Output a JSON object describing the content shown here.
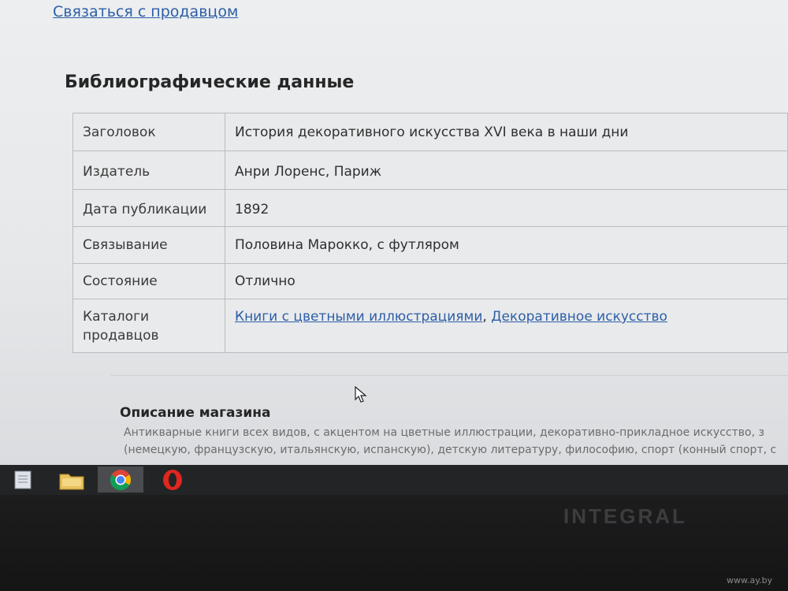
{
  "page": {
    "contact_link": "Связаться с продавцом",
    "section_title": "Библиографические данные"
  },
  "biblio": {
    "rows": [
      {
        "label": "Заголовок",
        "value": "История декоративного искусства XVI века в наши дни"
      },
      {
        "label": "Издатель",
        "value": "Анри Лоренс, Париж"
      },
      {
        "label": "Дата публикации",
        "value": "1892"
      },
      {
        "label": "Связывание",
        "value": "Половина Марокко, с футляром"
      },
      {
        "label": "Состояние",
        "value": "Отлично"
      }
    ],
    "catalogs": {
      "label_line1": "Каталоги",
      "label_line2": "продавцов",
      "link1": "Книги с цветными иллюстрациями",
      "separator": ",",
      "link2": "Декоративное искусство"
    }
  },
  "shop": {
    "title": "Описание магазина",
    "desc_line1": "Антикварные книги всех видов, с акцентом на цветные иллюстрации, декоративно-прикладное искусство, з",
    "desc_line2": "(немецкую, французскую, итальянскую, испанскую), детскую литературу, философию, спорт (конный спорт, с"
  },
  "taskbar": {
    "icons": [
      "notepad-icon",
      "file-explorer-icon",
      "chrome-icon",
      "opera-icon"
    ]
  },
  "monitor": {
    "brand": "INTEGRAL",
    "watermark": "www.ay.by"
  },
  "colors": {
    "link": "#2d5fa6",
    "text": "#2f2f2f"
  }
}
